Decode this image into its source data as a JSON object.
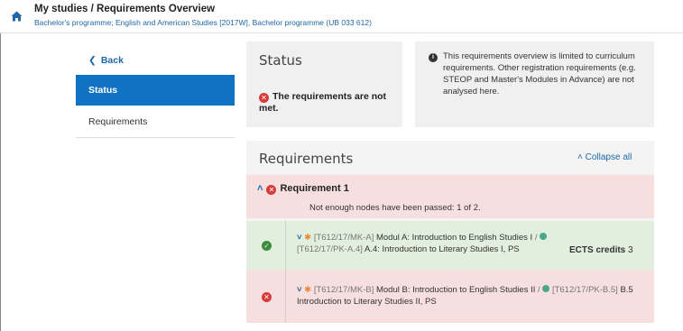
{
  "header": {
    "title": "My studies / Requirements Overview",
    "subtitle": "Bachelor's programme; English and American Studies [2017W], Bachelor programme (UB 033 612)"
  },
  "sidebar": {
    "back_label": "Back",
    "items": [
      {
        "label": "Status"
      },
      {
        "label": "Requirements"
      }
    ]
  },
  "status": {
    "heading": "Status",
    "message": "The requirements are not met."
  },
  "info": {
    "text": "This requirements overview is limited to curriculum requirements. Other registration requirements (e.g. STEOP and Master's Modules in Advance) are not analysed here."
  },
  "requirements": {
    "heading": "Requirements",
    "collapse_label": "Collapse all",
    "requirement": {
      "title": "Requirement 1",
      "summary": "Not enough nodes have been passed: 1 of 2."
    },
    "rows": [
      {
        "code1": "[T612/17/MK-A]",
        "name1": "Modul A: Introduction to English Studies I",
        "separator": "/",
        "code2": "[T612/17/PK-A.4]",
        "name2": "A.4: Introduction to Literary Studies I, PS",
        "ects_label": "ECTS credits",
        "ects_value": "3"
      },
      {
        "code1": "[T612/17/MK-B]",
        "name1": "Modul B: Introduction to English Studies II",
        "separator": "/",
        "code2": "[T612/17/PK-B.5]",
        "name2": "B.5 Introduction to Literary Studies II, PS"
      }
    ]
  },
  "colors": {
    "accent": "#0f72c2",
    "error": "#d63b3b",
    "success": "#3d8b3d",
    "error_bg": "#f7dfe0",
    "success_bg": "#e2efdf"
  },
  "icons": {
    "home": "home-icon",
    "back": "chevron-left-icon",
    "status_error": "error-circle-icon",
    "info": "info-icon",
    "collapse": "chevron-up-icon",
    "passed": "check-circle-icon",
    "expand": "chevron-down-icon",
    "module": "module-star-icon",
    "course": "course-dot-icon"
  }
}
